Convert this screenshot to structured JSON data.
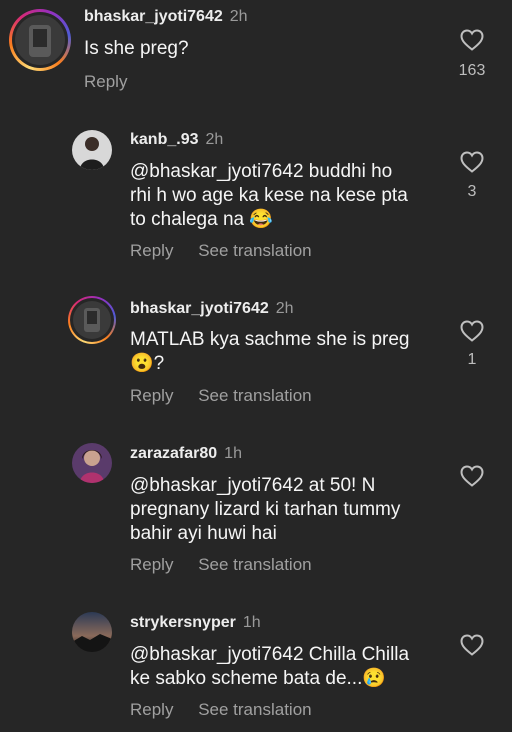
{
  "comments": [
    {
      "username": "bhaskar_jyoti7642",
      "time": "2h",
      "text": "Is she preg?",
      "reply_label": "Reply",
      "like_count": "163"
    },
    {
      "username": "kanb_.93",
      "time": "2h",
      "text_lines": [
        "@bhaskar_jyoti7642 buddhi ho",
        "rhi h wo age ka kese na kese pta",
        "to chalega na"
      ],
      "emoji": "😂",
      "reply_label": "Reply",
      "translate_label": "See translation",
      "like_count": "3"
    },
    {
      "username": "bhaskar_jyoti7642",
      "time": "2h",
      "text_lines": [
        "MATLAB kya sachme she is preg"
      ],
      "emoji": "😮",
      "emoji_suffix": "?",
      "reply_label": "Reply",
      "translate_label": "See translation",
      "like_count": "1"
    },
    {
      "username": "zarazafar80",
      "time": "1h",
      "text_lines": [
        "@bhaskar_jyoti7642 at 50! N",
        "pregnany lizard ki tarhan tummy",
        "bahir ayi huwi hai"
      ],
      "reply_label": "Reply",
      "translate_label": "See translation"
    },
    {
      "username": "strykersnyper",
      "time": "1h",
      "text_lines": [
        "@bhaskar_jyoti7642 Chilla Chilla",
        "ke sabko scheme bata de..."
      ],
      "emoji": "😢",
      "reply_label": "Reply",
      "translate_label": "See translation"
    }
  ]
}
